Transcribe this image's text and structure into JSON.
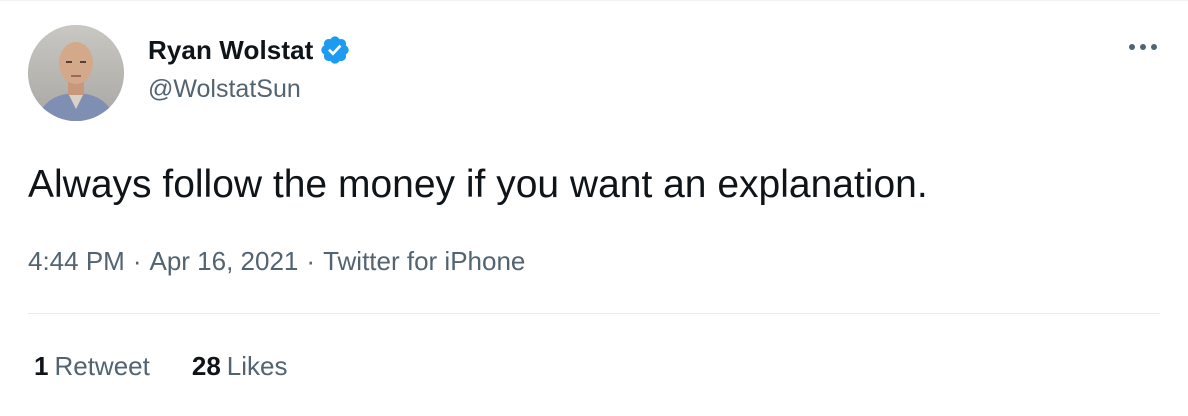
{
  "author": {
    "display_name": "Ryan Wolstat",
    "handle": "@WolstatSun",
    "verified": true,
    "avatar_icon": "user-avatar-photo"
  },
  "menu": {
    "icon": "more-horizontal-icon"
  },
  "tweet": {
    "text": "Always follow the money if you want an explanation.",
    "time": "4:44 PM",
    "separator": "·",
    "date": "Apr 16, 2021",
    "source": "Twitter for iPhone"
  },
  "stats": {
    "retweets_count": "1",
    "retweets_label": "Retweet",
    "likes_count": "28",
    "likes_label": "Likes"
  },
  "colors": {
    "text_primary": "#0f1419",
    "text_secondary": "#536471",
    "verified_blue": "#1d9bf0",
    "divider": "#e6ecf0"
  }
}
